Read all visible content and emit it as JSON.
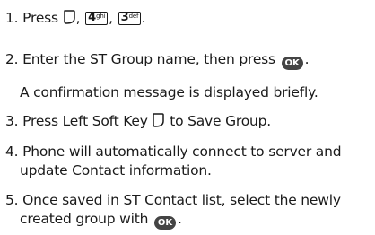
{
  "steps": [
    {
      "number": "1.",
      "text_a": "Press",
      "keys": [
        {
          "digit": "4",
          "letters": "ghi"
        },
        {
          "digit": "3",
          "letters": "def"
        }
      ],
      "sep": ",",
      "end": "."
    },
    {
      "number": "2.",
      "text_a": "Enter the ST Group name, then press",
      "ok_label": "OK",
      "end": ".",
      "note": "A confirmation message is displayed briefly."
    },
    {
      "number": "3.",
      "text_a": "Press Left Soft Key",
      "text_b": "to Save Group."
    },
    {
      "number": "4.",
      "line1": "Phone will automatically connect to server and",
      "line2": "update Contact information."
    },
    {
      "number": "5.",
      "line1": "Once saved in ST Contact list, select the newly",
      "line2_a": "created group with",
      "ok_label": "OK",
      "end": "."
    }
  ],
  "icons": {
    "soft_key": "left-soft-key-icon",
    "ok_key": "ok-key-icon"
  }
}
